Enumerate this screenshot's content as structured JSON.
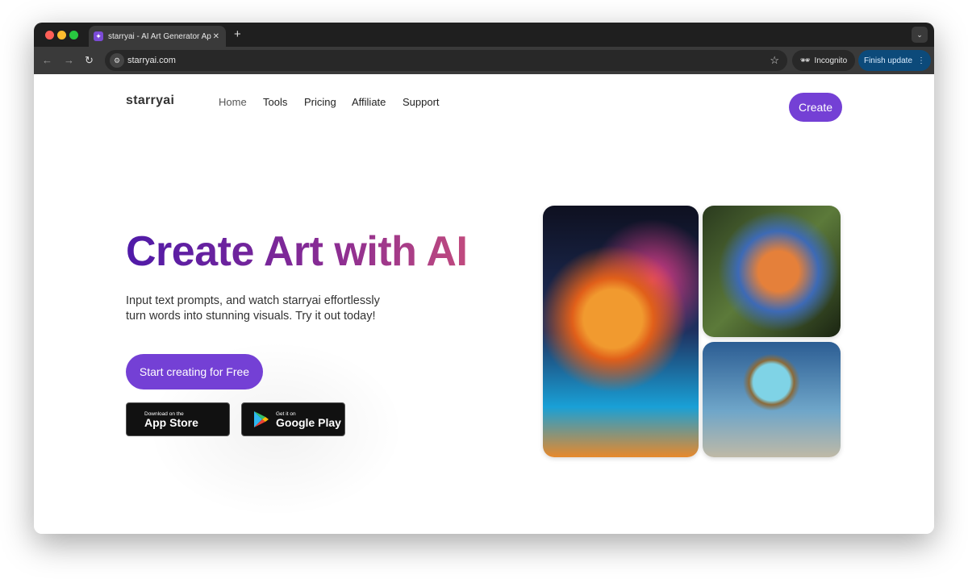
{
  "browser": {
    "tab_title": "starryai - AI Art Generator Ap",
    "url": "starryai.com",
    "incognito_label": "Incognito",
    "update_label": "Finish update"
  },
  "site": {
    "logo": "starryai",
    "nav": [
      "Home",
      "Tools",
      "Pricing",
      "Affiliate",
      "Support"
    ],
    "create_label": "Create",
    "hero": {
      "title": "Create Art with AI",
      "subtitle_line1": "Input text prompts, and watch starryai effortlessly",
      "subtitle_line2": "turn words into stunning visuals. Try it out today!",
      "cta": "Start creating for Free"
    },
    "badges": {
      "appstore_small": "Download on the",
      "appstore_large": "App Store",
      "play_small": "Get it on",
      "play_large": "Google Play"
    }
  },
  "colors": {
    "accent": "#7440d5",
    "update_bg": "#0c4a7a"
  }
}
